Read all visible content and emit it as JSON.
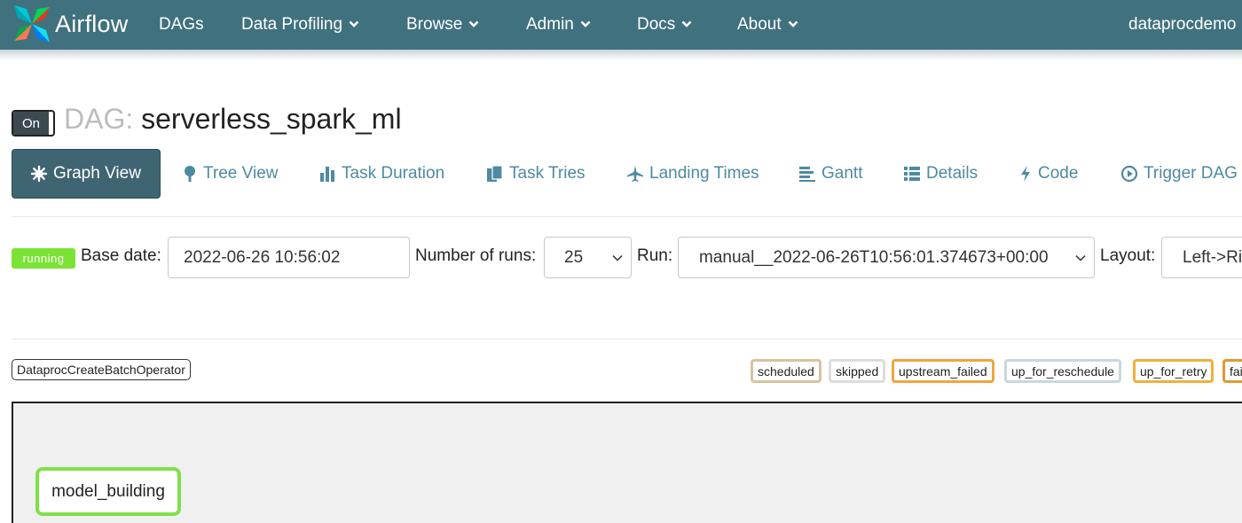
{
  "navbar": {
    "brand": "Airflow",
    "items": [
      {
        "label": "DAGs",
        "dropdown": false
      },
      {
        "label": "Data Profiling",
        "dropdown": true
      },
      {
        "label": "Browse",
        "dropdown": true
      },
      {
        "label": "Admin",
        "dropdown": true
      },
      {
        "label": "Docs",
        "dropdown": true
      },
      {
        "label": "About",
        "dropdown": true
      }
    ],
    "user": "dataprocdemo",
    "color": "#40717e"
  },
  "dag": {
    "toggle_label": "On",
    "title_prefix": "DAG:",
    "name": "serverless_spark_ml"
  },
  "tabs": [
    {
      "label": "Graph View",
      "icon": "asterisk-icon",
      "active": true
    },
    {
      "label": "Tree View",
      "icon": "tree-icon",
      "active": false
    },
    {
      "label": "Task Duration",
      "icon": "bar-chart-icon",
      "active": false
    },
    {
      "label": "Task Tries",
      "icon": "files-icon",
      "active": false
    },
    {
      "label": "Landing Times",
      "icon": "plane-icon",
      "active": false
    },
    {
      "label": "Gantt",
      "icon": "gantt-icon",
      "active": false
    },
    {
      "label": "Details",
      "icon": "list-icon",
      "active": false
    },
    {
      "label": "Code",
      "icon": "flash-icon",
      "active": false
    },
    {
      "label": "Trigger DAG",
      "icon": "play-circle-icon",
      "active": false
    }
  ],
  "controls": {
    "state": "running",
    "base_date_label": "Base date:",
    "base_date_value": "2022-06-26 10:56:02",
    "num_runs_label": "Number of runs:",
    "num_runs_value": "25",
    "run_label": "Run:",
    "run_value": "manual__2022-06-26T10:56:01.374673+00:00",
    "layout_label": "Layout:",
    "layout_value": "Left->Ri"
  },
  "legend": {
    "operator": "DataprocCreateBatchOperator",
    "states": [
      {
        "label": "scheduled",
        "color": "#d2b48c"
      },
      {
        "label": "skipped",
        "color": "#ffc0cb"
      },
      {
        "label": "upstream_failed",
        "color": "#ffa500"
      },
      {
        "label": "up_for_reschedule",
        "color": "#40e0d0"
      },
      {
        "label": "up_for_retry",
        "color": "#ffd700"
      },
      {
        "label": "fai",
        "color": "#ff0000"
      }
    ]
  },
  "graph": {
    "nodes": [
      {
        "label": "model_building",
        "state_color": "#7fe04a"
      }
    ]
  }
}
